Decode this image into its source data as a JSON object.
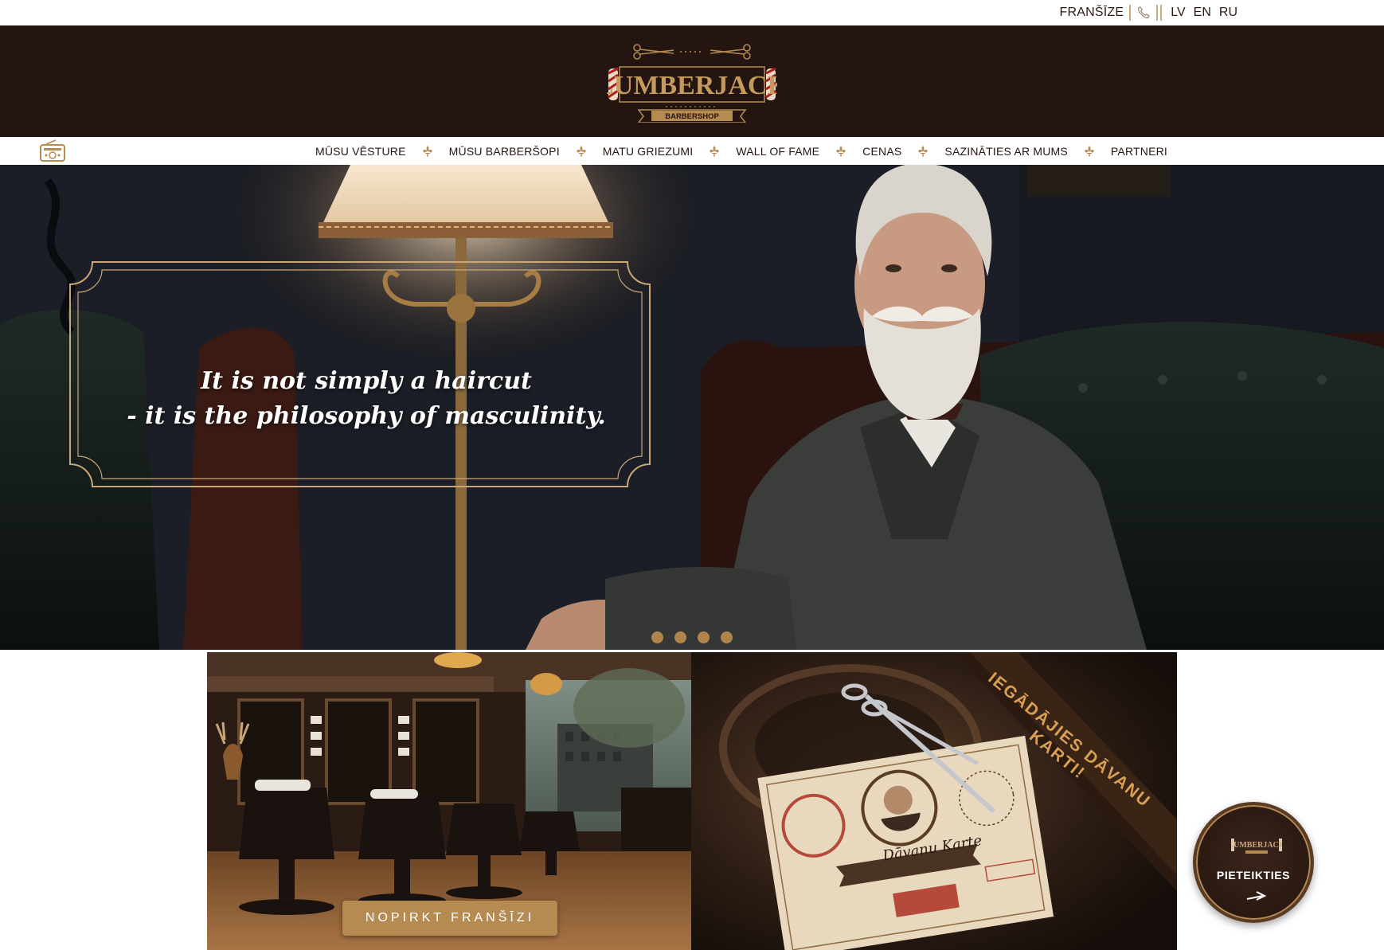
{
  "topbar": {
    "franchise_label": "FRANŠĪZE",
    "phone_icon": "phone-icon",
    "languages": [
      "LV",
      "EN",
      "RU"
    ]
  },
  "header": {
    "logo_text": "LUMBERJACK",
    "logo_subtitle": "BARBERSHOP"
  },
  "nav": {
    "radio_icon": "radio-icon",
    "separator_icon": "fleur-de-lis-icon",
    "items": [
      {
        "label": "MŪSU VĒSTURE"
      },
      {
        "label": "MŪSU BARBERŠOPI"
      },
      {
        "label": "MATU GRIEZUMI"
      },
      {
        "label": "WALL OF FAME"
      },
      {
        "label": "CENAS"
      },
      {
        "label": "SAZINĀTIES AR MUMS"
      },
      {
        "label": "PARTNERI"
      }
    ]
  },
  "hero": {
    "quote_line1": "It is not simply a haircut",
    "quote_line2": "- it is the philosophy of masculinity.",
    "slide_count": 4
  },
  "promos": {
    "franchise_button": "NOPIRKT FRANŠĪZI",
    "gift_ribbon": "IEGĀDĀJIES DĀVANU KARTI!",
    "gift_card_title": "Dāvanu Karte"
  },
  "booking_badge": {
    "logo_text": "LUMBERJACK",
    "label": "PIETEIKTIES",
    "arrow_icon": "arrow-right-icon"
  },
  "colors": {
    "header_bg": "#241511",
    "gold": "#b58b52",
    "white": "#ffffff"
  }
}
